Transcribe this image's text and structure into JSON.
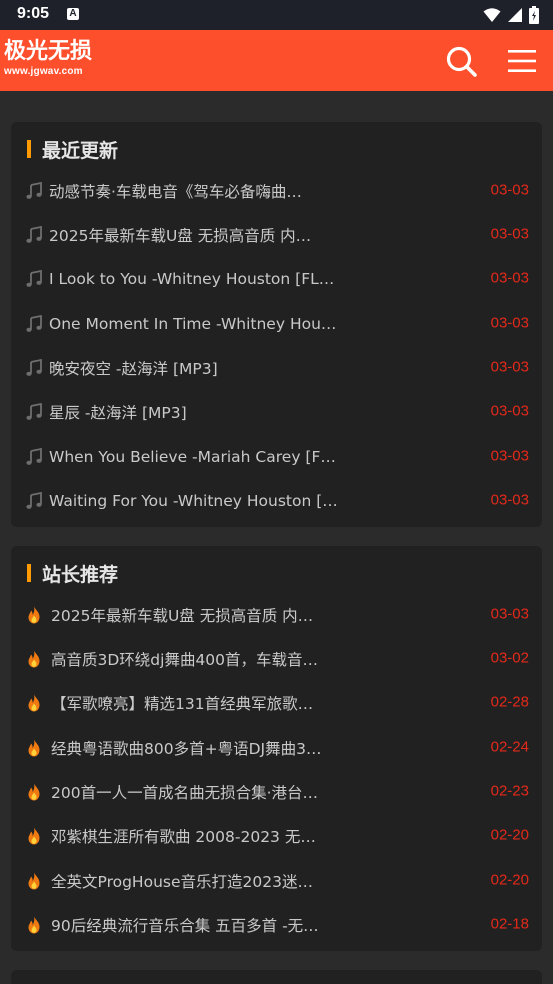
{
  "status_bar": {
    "time": "9:05",
    "notification_letter": "A"
  },
  "header": {
    "logo_cn": "极光无损",
    "logo_url": "www.jgwav.com",
    "brand_color": "#fd4f2c"
  },
  "sections": [
    {
      "title": "最近更新",
      "icon": "music-note-icon",
      "items": [
        {
          "title": "动感节奏·车载电音《驾车必备嗨曲…",
          "date": "03-03"
        },
        {
          "title": "2025年最新车载U盘 无损高音质 内…",
          "date": "03-03"
        },
        {
          "title": "I Look to You -Whitney Houston [FL…",
          "date": "03-03"
        },
        {
          "title": "One Moment In Time -Whitney Hous…",
          "date": "03-03"
        },
        {
          "title": "晚安夜空 -赵海洋 [MP3]",
          "date": "03-03"
        },
        {
          "title": "星辰 -赵海洋 [MP3]",
          "date": "03-03"
        },
        {
          "title": "When You Believe -Mariah Carey [FL…",
          "date": "03-03"
        },
        {
          "title": "Waiting For You -Whitney Houston […",
          "date": "03-03"
        }
      ]
    },
    {
      "title": "站长推荐",
      "icon": "fire-icon",
      "items": [
        {
          "title": "2025年最新车载U盘 无损高音质 内…",
          "date": "03-03"
        },
        {
          "title": "高音质3D环绕dj舞曲400首，车载音…",
          "date": "03-02"
        },
        {
          "title": "【军歌嘹亮】精选131首经典军旅歌…",
          "date": "02-28"
        },
        {
          "title": "经典粤语歌曲800多首+粤语DJ舞曲3…",
          "date": "02-24"
        },
        {
          "title": "200首一人一首成名曲无损合集·港台…",
          "date": "02-23"
        },
        {
          "title": "邓紫棋生涯所有歌曲 2008-2023 无…",
          "date": "02-20"
        },
        {
          "title": "全英文ProgHouse音乐打造2023迷…",
          "date": "02-20"
        },
        {
          "title": "90后经典流行音乐合集 五百多首 -无…",
          "date": "02-18"
        }
      ]
    }
  ]
}
